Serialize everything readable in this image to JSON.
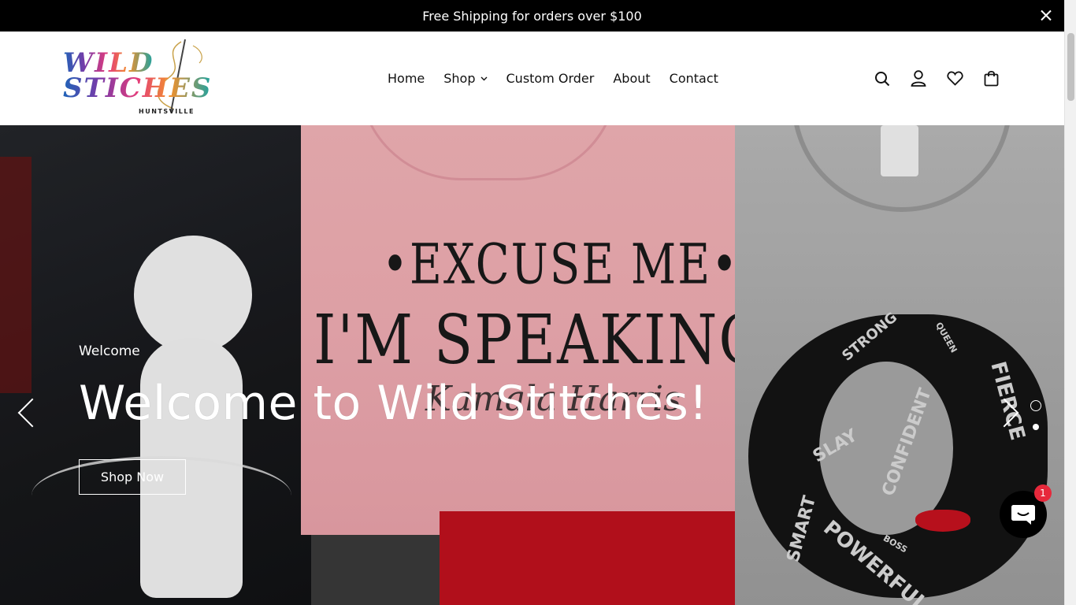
{
  "announcement": {
    "text": "Free Shipping for orders over $100",
    "close_icon": "close-icon"
  },
  "brand": {
    "logo_line1": "WILD",
    "logo_line2": "STICHES",
    "logo_sub": "HUNTSVILLE",
    "logo_icon": "needle-thread-icon"
  },
  "nav": {
    "items": [
      {
        "label": "Home"
      },
      {
        "label": "Shop",
        "has_dropdown": true,
        "icon": "chevron-down-icon"
      },
      {
        "label": "Custom Order"
      },
      {
        "label": "About"
      },
      {
        "label": "Contact"
      }
    ]
  },
  "header_icons": [
    "search-icon",
    "account-icon",
    "wishlist-heart-icon",
    "cart-bag-icon"
  ],
  "hero": {
    "subtitle": "Welcome",
    "title": "Welcome to Wild Stitches!",
    "cta_label": "Shop Now",
    "image_text": {
      "line1": "•EXCUSE ME•",
      "line2": "I'M SPEAKING",
      "signature": "Kamala Harris"
    },
    "hair_words": [
      "STRONG",
      "QUEEN",
      "FIERCE",
      "SLAY",
      "CONFIDENT",
      "SMART",
      "POWERFUL",
      "BOSS"
    ],
    "slides_total": 2,
    "active_slide": 2,
    "prev_icon": "chevron-left-icon",
    "next_icon": "chevron-right-icon"
  },
  "chat": {
    "icon": "chat-bubble-icon",
    "badge_count": "1"
  },
  "colors": {
    "announcement_bg": "#000000",
    "chat_badge": "#e7283b"
  }
}
